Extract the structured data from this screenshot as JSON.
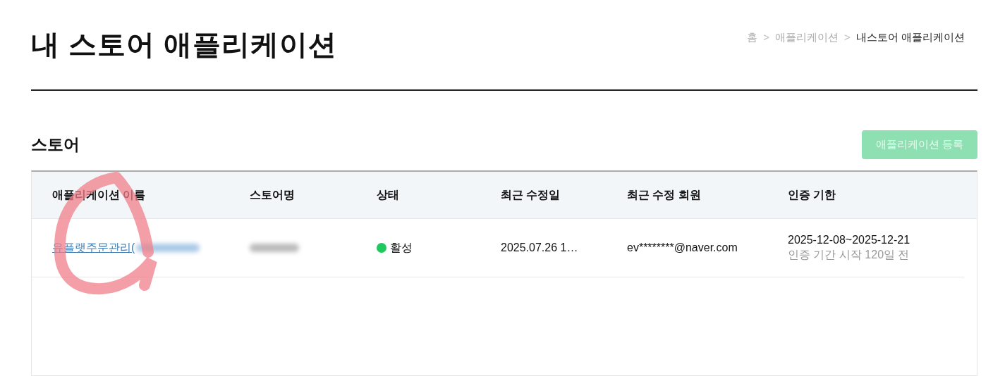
{
  "page": {
    "title": "내 스토어 애플리케이션"
  },
  "breadcrumb_separator": ">",
  "breadcrumb": [
    {
      "label": "홈",
      "current": false
    },
    {
      "label": "애플리케이션",
      "current": false
    },
    {
      "label": "내스토어 애플리케이션",
      "current": true
    }
  ],
  "section": {
    "title": "스토어",
    "register_button": {
      "label": "애플리케이션 등록",
      "disabled": true
    }
  },
  "table": {
    "columns": [
      "애플리케이션 이름",
      "스토어명",
      "상태",
      "최근 수정일",
      "최근 수정 회원",
      "인증 기한"
    ],
    "rows": [
      {
        "app_name": "유플랫주문관리(",
        "app_name_blurred": true,
        "store_name_blurred": true,
        "status": {
          "label": "활성",
          "color": "#1ec95d"
        },
        "modified_date": "2025.07.26 1…",
        "modified_by": "ev********@naver.com",
        "cert_period": "2025-12-08~2025-12-21",
        "cert_note": "인증 기간 시작 120일 전"
      }
    ]
  },
  "annotation": {
    "kind": "freehand-circle"
  }
}
